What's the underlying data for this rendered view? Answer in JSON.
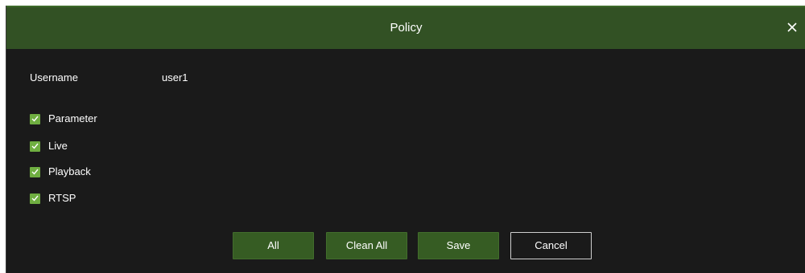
{
  "dialog": {
    "title": "Policy",
    "close_icon": "close-icon"
  },
  "user": {
    "label": "Username",
    "value": "user1"
  },
  "permissions": [
    {
      "label": "Parameter",
      "checked": true
    },
    {
      "label": "Live",
      "checked": true
    },
    {
      "label": "Playback",
      "checked": true
    },
    {
      "label": "RTSP",
      "checked": true
    }
  ],
  "buttons": {
    "all": "All",
    "clean_all": "Clean All",
    "save": "Save",
    "cancel": "Cancel"
  },
  "colors": {
    "titlebar": "#325124",
    "background": "#1a1a1a",
    "checkbox": "#6fae41",
    "button": "#365c23"
  }
}
